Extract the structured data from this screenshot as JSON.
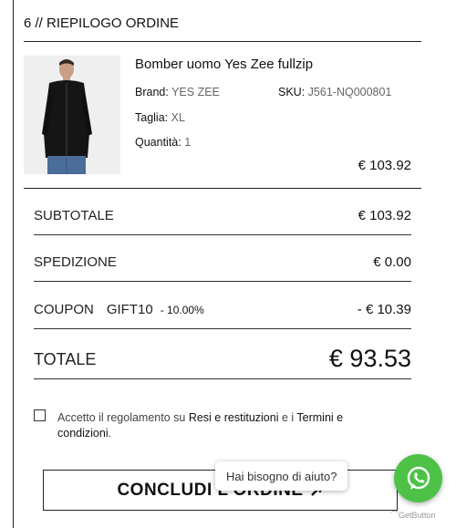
{
  "section": {
    "title": "6 // RIEPILOGO ORDINE"
  },
  "product": {
    "name": "Bomber uomo Yes Zee fullzip",
    "brand_label": "Brand:",
    "brand_value": "YES ZEE",
    "sku_label": "SKU:",
    "sku_value": "J561-NQ000801",
    "size_label": "Taglia:",
    "size_value": "XL",
    "qty_label": "Quantità:",
    "qty_value": "1",
    "price": "€ 103.92"
  },
  "summary": {
    "subtotal_label": "SUBTOTALE",
    "subtotal_value": "€ 103.92",
    "shipping_label": "SPEDIZIONE",
    "shipping_value": "€ 0.00",
    "coupon_label": "COUPON",
    "coupon_code": "GIFT10",
    "coupon_percent": "- 10.00%",
    "coupon_value": "- € 10.39",
    "total_label": "TOTALE",
    "total_value": "€ 93.53"
  },
  "terms": {
    "text_1": "Accetto il regolamento su ",
    "link_1": "Resi e restituzioni",
    "text_2": " e i ",
    "link_2": "Termini e condizioni",
    "text_3": "."
  },
  "submit": {
    "label": "CONCLUDI L'ORDINE"
  },
  "chat": {
    "bubble_text": "Hai bisogno di aiuto?",
    "provider": "GetButton"
  },
  "colors": {
    "whatsapp": "#4dc247"
  }
}
